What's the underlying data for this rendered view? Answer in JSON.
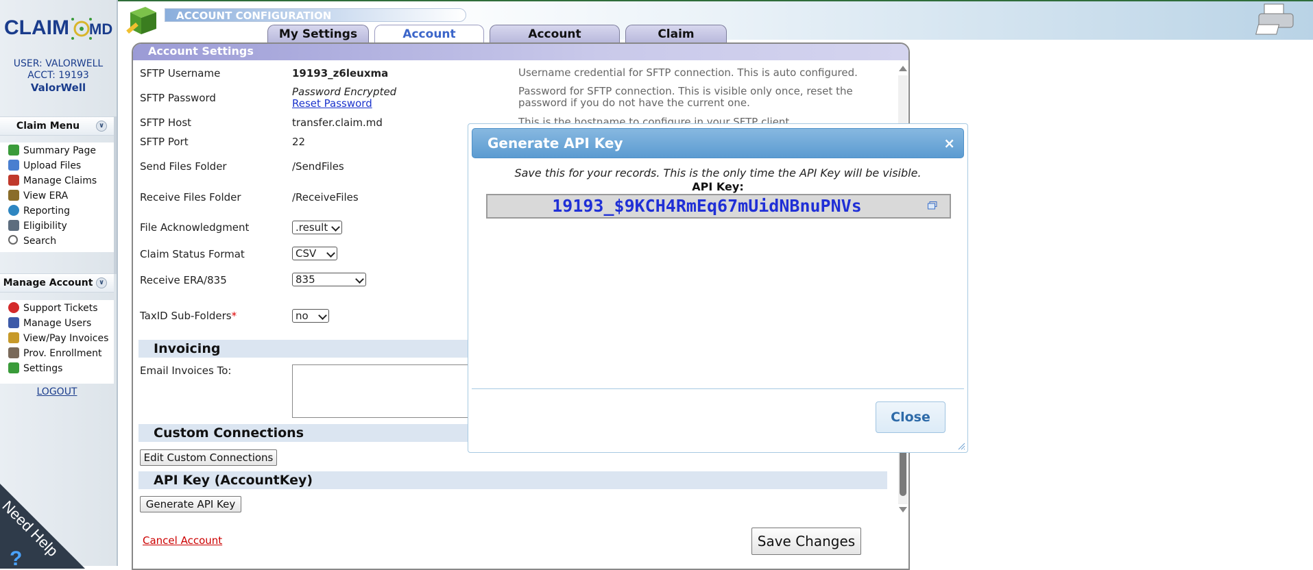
{
  "app": {
    "section_title": "ACCOUNT CONFIGURATION",
    "logo_text": "CLAIM.MD"
  },
  "user": {
    "user_line": "USER: VALORWELL",
    "acct_line": "ACCT: 19193",
    "practice": "ValorWell"
  },
  "sidebar": {
    "claim_menu_title": "Claim Menu",
    "claim_items": [
      {
        "label": "Summary Page",
        "icon": "summary-icon",
        "color": "#3a9b3a"
      },
      {
        "label": "Upload Files",
        "icon": "upload-icon",
        "color": "#4a7fd0"
      },
      {
        "label": "Manage Claims",
        "icon": "claims-icon",
        "color": "#c0392b"
      },
      {
        "label": "View ERA",
        "icon": "era-icon",
        "color": "#8a6d2a"
      },
      {
        "label": "Reporting",
        "icon": "reporting-icon",
        "color": "#2e86c1"
      },
      {
        "label": "Eligibility",
        "icon": "eligibility-icon",
        "color": "#5d6d7e"
      },
      {
        "label": "Search",
        "icon": "search-icon",
        "color": "#666666"
      }
    ],
    "manage_title": "Manage Account",
    "manage_items": [
      {
        "label": "Support Tickets",
        "icon": "support-icon",
        "color": "#d42a2a"
      },
      {
        "label": "Manage Users",
        "icon": "users-icon",
        "color": "#3d5aa8"
      },
      {
        "label": "View/Pay Invoices",
        "icon": "invoices-icon",
        "color": "#c79a2a"
      },
      {
        "label": "Prov. Enrollment",
        "icon": "enrollment-icon",
        "color": "#7a6a5a"
      },
      {
        "label": "Settings",
        "icon": "settings-icon",
        "color": "#3a9b3a"
      }
    ],
    "logout": "LOGOUT",
    "help": "Need Help"
  },
  "tabs": [
    {
      "label": "My Settings",
      "active": false
    },
    {
      "label": "Account Settings",
      "active": true
    },
    {
      "label": "Account Information",
      "active": false
    },
    {
      "label": "Claim Grouping",
      "active": false
    }
  ],
  "panel": {
    "title": "Account Settings",
    "sftp_username_label": "SFTP Username",
    "sftp_username_value": "19193_z6leuxma",
    "sftp_username_desc": "Username credential for SFTP connection. This is auto configured.",
    "sftp_password_label": "SFTP Password",
    "sftp_password_value": "Password Encrypted",
    "reset_password": "Reset Password",
    "sftp_password_desc": "Password for SFTP connection. This is visible only once, reset the password if you do not have the current one.",
    "sftp_host_label": "SFTP Host",
    "sftp_host_value": "transfer.claim.md",
    "sftp_host_desc": "This is the hostname to configure in your SFTP client.",
    "sftp_port_label": "SFTP Port",
    "sftp_port_value": "22",
    "send_folder_label": "Send Files Folder",
    "send_folder_value": "/SendFiles",
    "receive_folder_label": "Receive Files Folder",
    "receive_folder_value": "/ReceiveFiles",
    "file_ack_label": "File Acknowledgment",
    "file_ack_value": ".result",
    "claim_status_label": "Claim Status Format",
    "claim_status_value": "CSV",
    "receive_era_label": "Receive ERA/835",
    "receive_era_value": "835",
    "taxid_label": "TaxID Sub-Folders",
    "taxid_required": "*",
    "taxid_value": "no",
    "invoicing_title": "Invoicing",
    "email_invoices_label": "Email Invoices To:",
    "custom_title": "Custom Connections",
    "edit_custom_button": "Edit Custom Connections",
    "api_title": "API Key (AccountKey)",
    "generate_button": "Generate API Key",
    "cancel_account": "Cancel Account",
    "save_button": "Save Changes"
  },
  "dialog": {
    "title": "Generate API Key",
    "close_x": "×",
    "message": "Save this for your records. This is the only time the API Key will be visible.",
    "key_label": "API Key:",
    "key_value": "19193_$9KCH4RmEq67mUidNBnuPNVs",
    "close_button": "Close"
  }
}
